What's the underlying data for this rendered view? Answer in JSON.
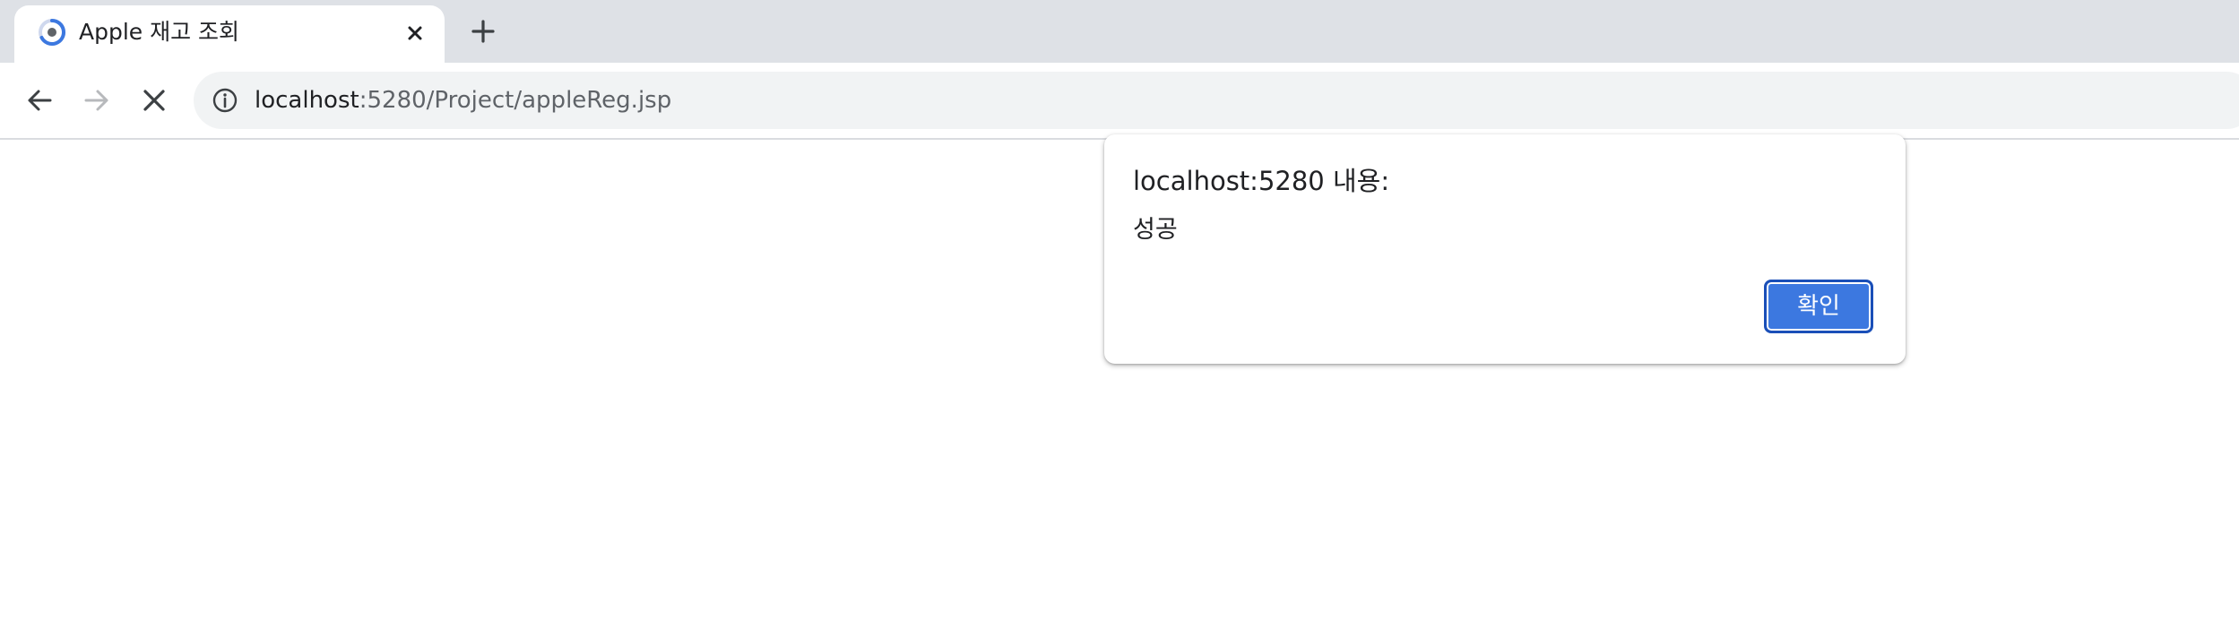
{
  "browser": {
    "tab": {
      "title": "Apple 재고 조회",
      "favicon": "loading-spinner-icon"
    },
    "address_bar": {
      "host": "localhost",
      "rest": ":5280/Project/appleReg.jsp"
    },
    "icons": {
      "back": "back-arrow-icon",
      "forward": "forward-arrow-icon",
      "stop": "stop-loading-icon",
      "info": "site-info-icon",
      "close_tab": "close-icon",
      "new_tab": "plus-icon"
    }
  },
  "dialog": {
    "title": "localhost:5280 내용:",
    "message": "성공",
    "ok_label": "확인"
  },
  "colors": {
    "tabstrip_bg": "#dee1e6",
    "omnibox_bg": "#f1f3f4",
    "accent": "#3c78e0"
  }
}
